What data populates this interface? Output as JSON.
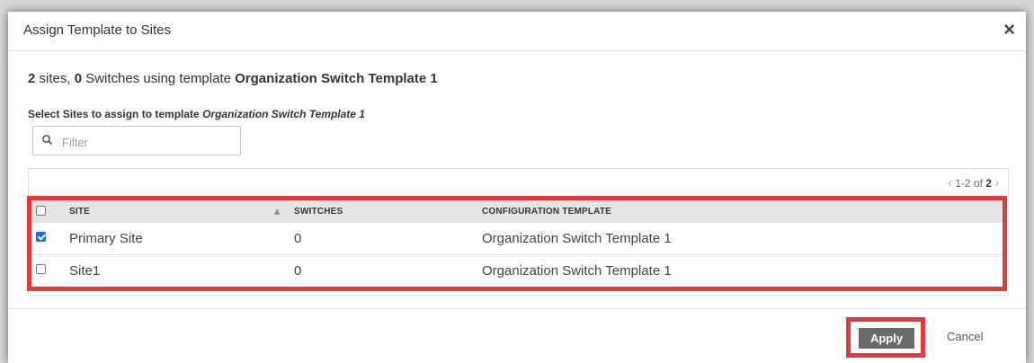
{
  "dialog": {
    "title": "Assign Template to Sites",
    "close_symbol": "×"
  },
  "summary": {
    "sites_count": "2",
    "sites_word": " sites, ",
    "switches_count": "0",
    "switches_text": " Switches using template ",
    "template_name": "Organization Switch Template 1"
  },
  "select_label": {
    "prefix": "Select Sites to assign to template ",
    "template_name": "Organization Switch Template 1"
  },
  "filter": {
    "placeholder": "Filter",
    "value": "",
    "icon": "search-icon"
  },
  "pager": {
    "prev_icon": "chevron-left-icon",
    "range": "1-2 of ",
    "total": "2",
    "next_icon": "chevron-right-icon"
  },
  "table": {
    "columns": [
      "SITE",
      "SWITCHES",
      "CONFIGURATION TEMPLATE"
    ],
    "sort_icon": "double-chevron-up-icon",
    "rows": [
      {
        "site": "Primary Site",
        "switches": "0",
        "template": "Organization Switch Template 1",
        "checked": true
      },
      {
        "site": "Site1",
        "switches": "0",
        "template": "Organization Switch Template 1",
        "checked": false
      }
    ]
  },
  "footer": {
    "apply_label": "Apply",
    "cancel_label": "Cancel"
  },
  "colors": {
    "highlight": "#e03a3a",
    "checkbox_checked": "#1a6fd1",
    "apply_button": "#6a6a6a",
    "header_row": "#e5e5e5"
  }
}
